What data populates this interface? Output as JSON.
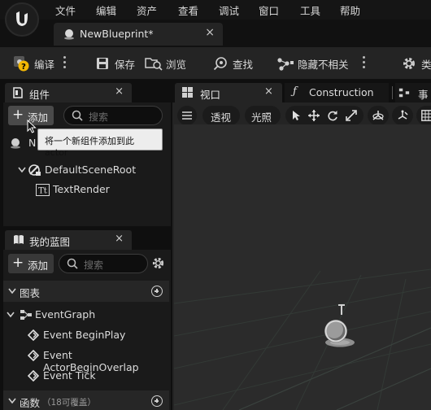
{
  "menu": [
    "文件",
    "编辑",
    "资产",
    "查看",
    "调试",
    "窗口",
    "工具",
    "帮助"
  ],
  "doc_tab": {
    "title": "NewBlueprint*",
    "close": "×"
  },
  "toolbar": {
    "compile": "编译",
    "save": "保存",
    "browse": "浏览",
    "find": "查找",
    "hide_unrelated": "隐藏不相关",
    "class_settings": "类"
  },
  "components_panel": {
    "tab_label": "组件",
    "close": "×",
    "add_label": "添加",
    "search_placeholder": "搜索",
    "root_name": "N",
    "tree": [
      "DefaultSceneRoot",
      "TextRender"
    ]
  },
  "tooltip": {
    "text": "将一个新组件添加到此actor"
  },
  "my_blueprint": {
    "tab_label": "我的蓝图",
    "close": "×",
    "add_label": "添加",
    "search_placeholder": "搜索",
    "graphs_header": "图表",
    "event_graph": "EventGraph",
    "events": [
      "Event BeginPlay",
      "Event ActorBeginOverlap",
      "Event Tick"
    ],
    "functions_header": "函数",
    "functions_note": "（18可覆盖）"
  },
  "viewport_tabs": {
    "viewport": "视口",
    "viewport_close": "×",
    "construction": "Construction",
    "events_partial": "事"
  },
  "viewport_toolbar": {
    "perspective": "透视",
    "lighting": "光照"
  },
  "colors": {
    "background": "#0f0f0f",
    "panel": "#1a1a1a",
    "tab_active": "#242424",
    "viewport": "#2b2b2b",
    "tooltip_bg": "#ededed",
    "compile_warning": "#f2b705"
  }
}
